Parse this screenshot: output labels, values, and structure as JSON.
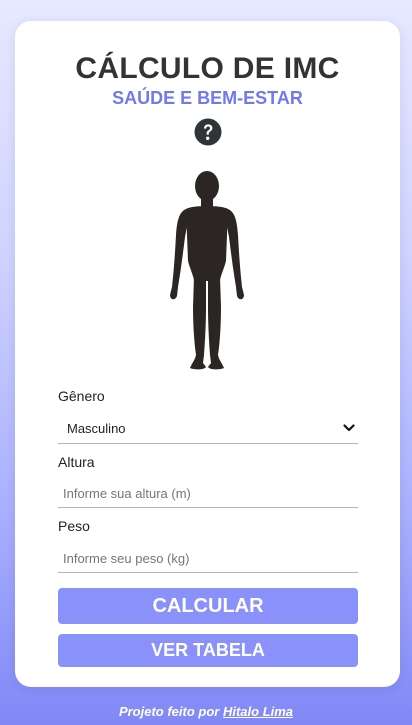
{
  "header": {
    "title": "CÁLCULO DE IMC",
    "subtitle": "SAÚDE E BEM-ESTAR"
  },
  "icons": {
    "help": "question-circle-icon",
    "figure": "human-silhouette-icon",
    "dropdown": "chevron-down-icon"
  },
  "form": {
    "gender": {
      "label": "Gênero",
      "value": "Masculino"
    },
    "height": {
      "label": "Altura",
      "placeholder": "Informe sua altura (m)"
    },
    "weight": {
      "label": "Peso",
      "placeholder": "Informe seu peso (kg)"
    }
  },
  "buttons": {
    "calculate": "CALCULAR",
    "table": "VER TABELA"
  },
  "footer": {
    "text": "Projeto feito por",
    "author": "Hitalo Lima"
  },
  "colors": {
    "accent": "#7179ee",
    "button": "#8a91fb",
    "title": "#333333",
    "figure": "#2b2624"
  }
}
